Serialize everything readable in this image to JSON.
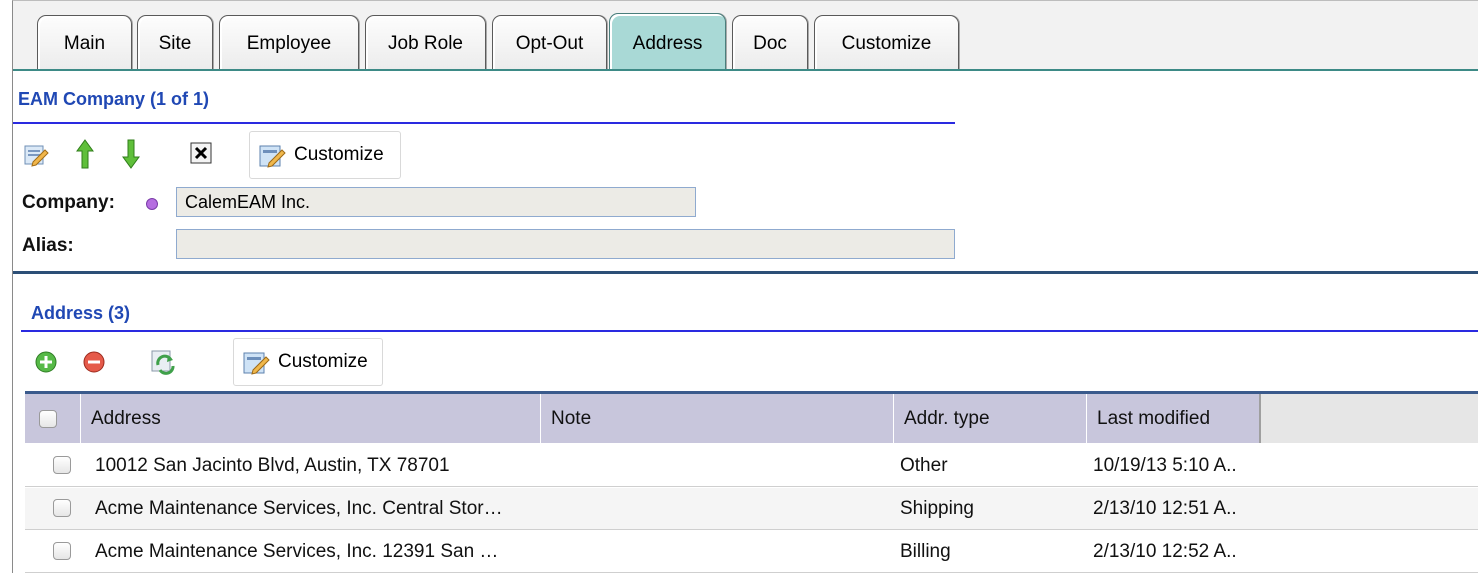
{
  "tabs": [
    {
      "label": "Main"
    },
    {
      "label": "Site"
    },
    {
      "label": "Employee"
    },
    {
      "label": "Job Role"
    },
    {
      "label": "Opt-Out"
    },
    {
      "label": "Address",
      "active": true
    },
    {
      "label": "Doc"
    },
    {
      "label": "Customize"
    }
  ],
  "company_section": {
    "title": "EAM Company (1 of 1)",
    "toolbar": {
      "edit_icon": "edit-form-icon",
      "up_icon": "arrow-up-icon",
      "down_icon": "arrow-down-icon",
      "close_icon": "close-box-icon",
      "customize_label": "Customize"
    },
    "fields": {
      "company_label": "Company:",
      "company_value": "CalemEAM Inc.",
      "alias_label": "Alias:",
      "alias_value": ""
    }
  },
  "address_section": {
    "title": "Address (3)",
    "toolbar": {
      "add_icon": "add-circle-icon",
      "remove_icon": "remove-circle-icon",
      "refresh_icon": "refresh-icon",
      "customize_label": "Customize"
    },
    "columns": [
      "Address",
      "Note",
      "Addr. type",
      "Last modified"
    ],
    "rows": [
      {
        "address": "10012 San Jacinto Blvd, Austin, TX 78701",
        "note": "",
        "type": "Other",
        "modified": "10/19/13 5:10 A.."
      },
      {
        "address": "Acme Maintenance Services, Inc. Central Stor…",
        "note": "",
        "type": "Shipping",
        "modified": "2/13/10 12:51 A.."
      },
      {
        "address": "Acme Maintenance Services, Inc. 12391 San …",
        "note": "",
        "type": "Billing",
        "modified": "2/13/10 12:52 A.."
      }
    ]
  },
  "colors": {
    "accent_blue": "#2048b4",
    "active_tab": "#a9d9d6",
    "header_bg": "#c8c6dc"
  }
}
